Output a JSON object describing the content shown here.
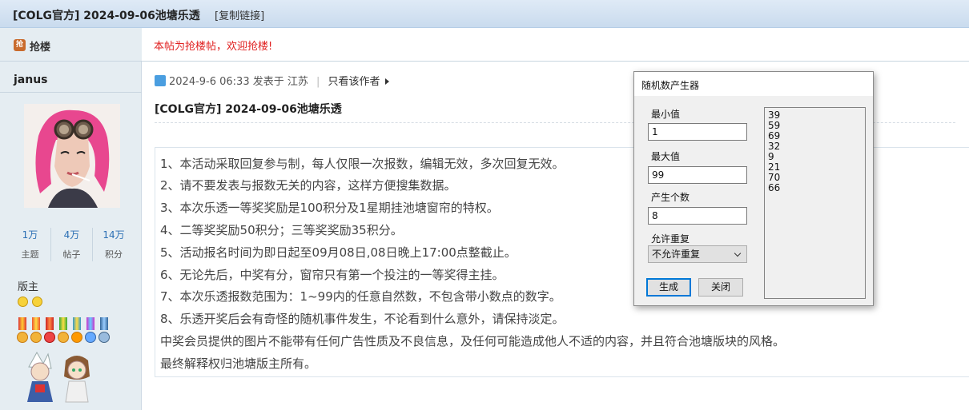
{
  "topbar": {
    "title": "[COLG官方] 2024-09-06池塘乐透",
    "copy_link": "[复制链接]"
  },
  "sidebar": {
    "qianglou_label": "抢楼",
    "qianglou_icon": "qianglou-icon",
    "username": "janus",
    "stats": [
      {
        "value": "1万",
        "label": "主题"
      },
      {
        "value": "4万",
        "label": "帖子"
      },
      {
        "value": "14万",
        "label": "积分"
      }
    ],
    "role": "版主"
  },
  "notice": "本帖为抢楼帖，欢迎抢楼!",
  "post": {
    "meta": "2024-9-6 06:33 发表于 江苏",
    "separator": "|",
    "only_author": "只看该作者",
    "title": "[COLG官方] 2024-09-06池塘乐透",
    "lines": [
      "1、本活动采取回复参与制，每人仅限一次报数，编辑无效，多次回复无效。",
      "2、请不要发表与报数无关的内容，这样方便搜集数据。",
      "3、本次乐透一等奖奖励是100积分及1星期挂池塘窗帘的特权。",
      "4、二等奖奖励50积分；三等奖奖励35积分。",
      "5、活动报名时间为即日起至09月08日,08日晚上17:00点整截止。",
      "6、无论先后，中奖有分，窗帘只有第一个投注的一等奖得主挂。",
      "7、本次乐透报数范围为：1~99内的任意自然数，不包含带小数点的数字。",
      "8、乐透开奖后会有奇怪的随机事件发生，不论看到什么意外，请保持淡定。",
      "中奖会员提供的图片不能带有任何广告性质及不良信息，及任何可能造成他人不适的内容，并且符合池塘版块的风格。",
      "最终解释权归池塘版主所有。"
    ]
  },
  "dialog": {
    "title": "随机数产生器",
    "min_label": "最小值",
    "min_value": "1",
    "max_label": "最大值",
    "max_value": "99",
    "count_label": "产生个数",
    "count_value": "8",
    "repeat_label": "允许重复",
    "repeat_selected": "不允许重复",
    "generate_label": "生成",
    "close_label": "关闭",
    "results": [
      "39",
      "59",
      "69",
      "32",
      "9",
      "21",
      "70",
      "66"
    ]
  },
  "colors": {
    "accent": "#0078d7",
    "notice_red": "#e02020",
    "stat_blue": "#2b6fb4",
    "sidebar_bg": "#e5edf2"
  }
}
